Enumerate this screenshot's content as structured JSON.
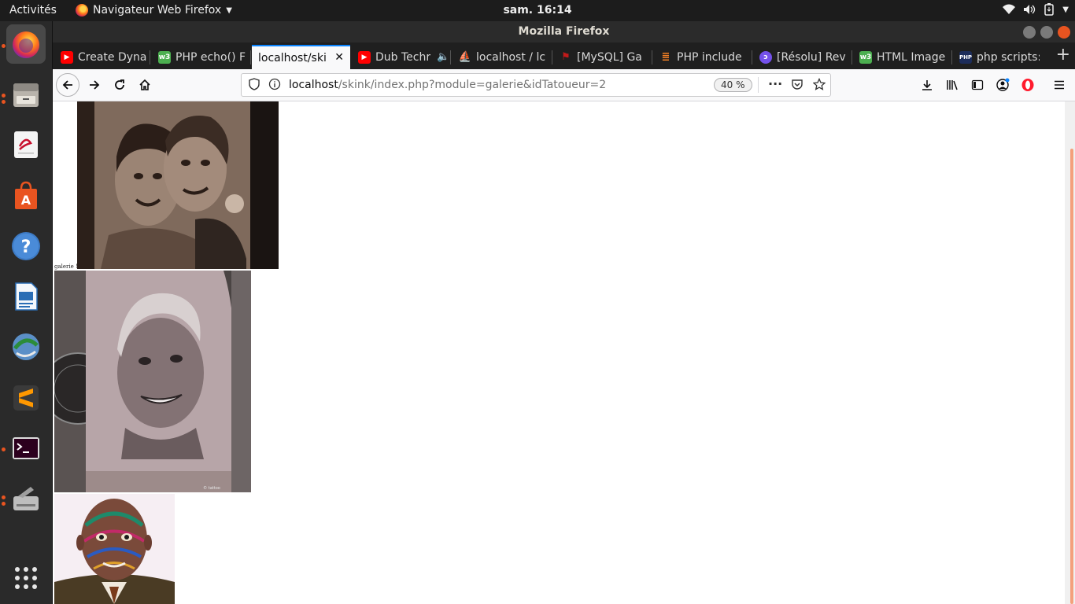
{
  "topbar": {
    "activities": "Activités",
    "app_menu": "Navigateur Web Firefox",
    "clock": "sam. 16:14"
  },
  "dock": {
    "items": [
      {
        "name": "firefox",
        "active": true
      },
      {
        "name": "files"
      },
      {
        "name": "evince"
      },
      {
        "name": "ubuntu-software"
      },
      {
        "name": "help"
      },
      {
        "name": "libreoffice-writer"
      },
      {
        "name": "network-manager"
      },
      {
        "name": "sublime-text"
      },
      {
        "name": "terminal"
      },
      {
        "name": "scanner"
      },
      {
        "name": "show-applications"
      }
    ]
  },
  "window": {
    "title": "Mozilla Firefox"
  },
  "tabs": [
    {
      "label": "Create Dyna",
      "icon": "youtube-icon",
      "color": "#ff0000"
    },
    {
      "label": "PHP echo() F",
      "icon": "w3-icon",
      "color": "#4caf50"
    },
    {
      "label": "localhost/ski",
      "icon": "",
      "selected": true
    },
    {
      "label": "Dub Techr",
      "icon": "youtube-icon",
      "color": "#ff0000"
    },
    {
      "label": "localhost / lc",
      "icon": "phpmyadmin-icon",
      "color": "#f5a623"
    },
    {
      "label": "[MySQL] Ga",
      "icon": "flag-icon",
      "color": "#c21a1a"
    },
    {
      "label": "PHP include",
      "icon": "stackoverflow-icon",
      "color": "#f48024"
    },
    {
      "label": "[Résolu] Rev",
      "icon": "openclassrooms-icon",
      "color": "#7451eb"
    },
    {
      "label": "HTML Image",
      "icon": "w3-icon",
      "color": "#4caf50"
    },
    {
      "label": "php scripts:",
      "icon": "php-icon",
      "color": "#1c2c5a"
    }
  ],
  "navbar": {
    "url_host": "localhost",
    "url_path": "/skink/index.php?module=galerie&idTatoueur=2",
    "zoom": "40 %"
  },
  "content": {
    "caption": "galerie !"
  }
}
